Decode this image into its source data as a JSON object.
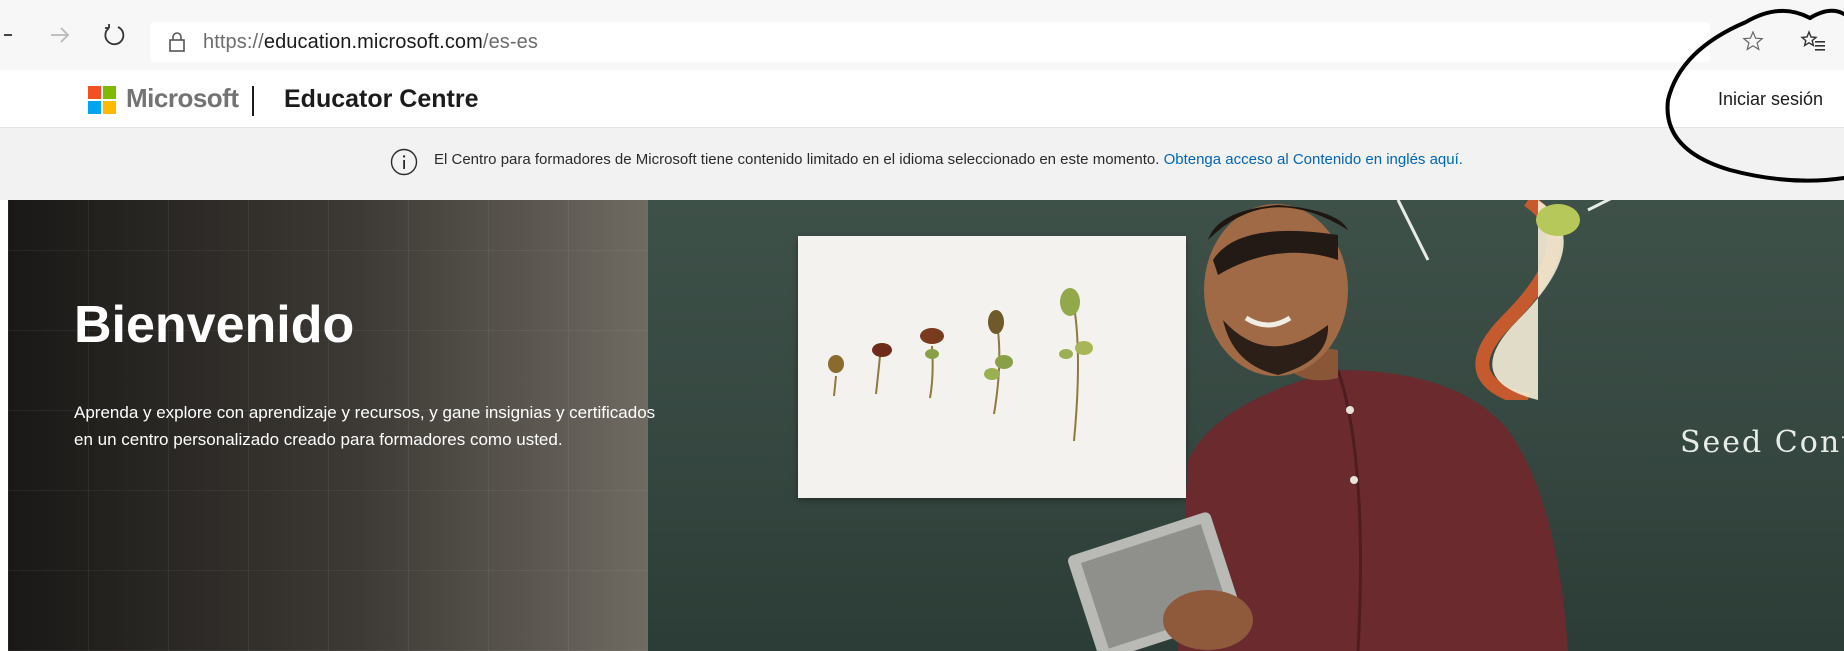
{
  "browser": {
    "url_scheme": "https://",
    "url_host": "education.microsoft.com",
    "url_path": "/es-es",
    "icons": [
      "back-icon",
      "forward-icon",
      "refresh-icon",
      "lock-icon",
      "favorite-star-icon",
      "favorites-list-icon"
    ]
  },
  "header": {
    "brand": "Microsoft",
    "site_title": "Educator Centre",
    "signin_label": "Iniciar sesión"
  },
  "notice": {
    "text": "El Centro para formadores de Microsoft tiene contenido limitado en el idioma seleccionado en este momento.",
    "link_text": "Obtenga acceso al Contenido en inglés aquí."
  },
  "hero": {
    "title": "Bienvenido",
    "description": "Aprenda y explore con aprendizaje y recursos, y gane insignias y certificados en un centro personalizado creado para formadores como usted.",
    "chalk_text": "Seed Cont"
  },
  "colors": {
    "ms_red": "#f25022",
    "ms_green": "#7fba00",
    "ms_blue": "#00a4ef",
    "ms_yellow": "#ffb900",
    "link": "#0067b8",
    "notice_bg": "#f2f2f2"
  }
}
